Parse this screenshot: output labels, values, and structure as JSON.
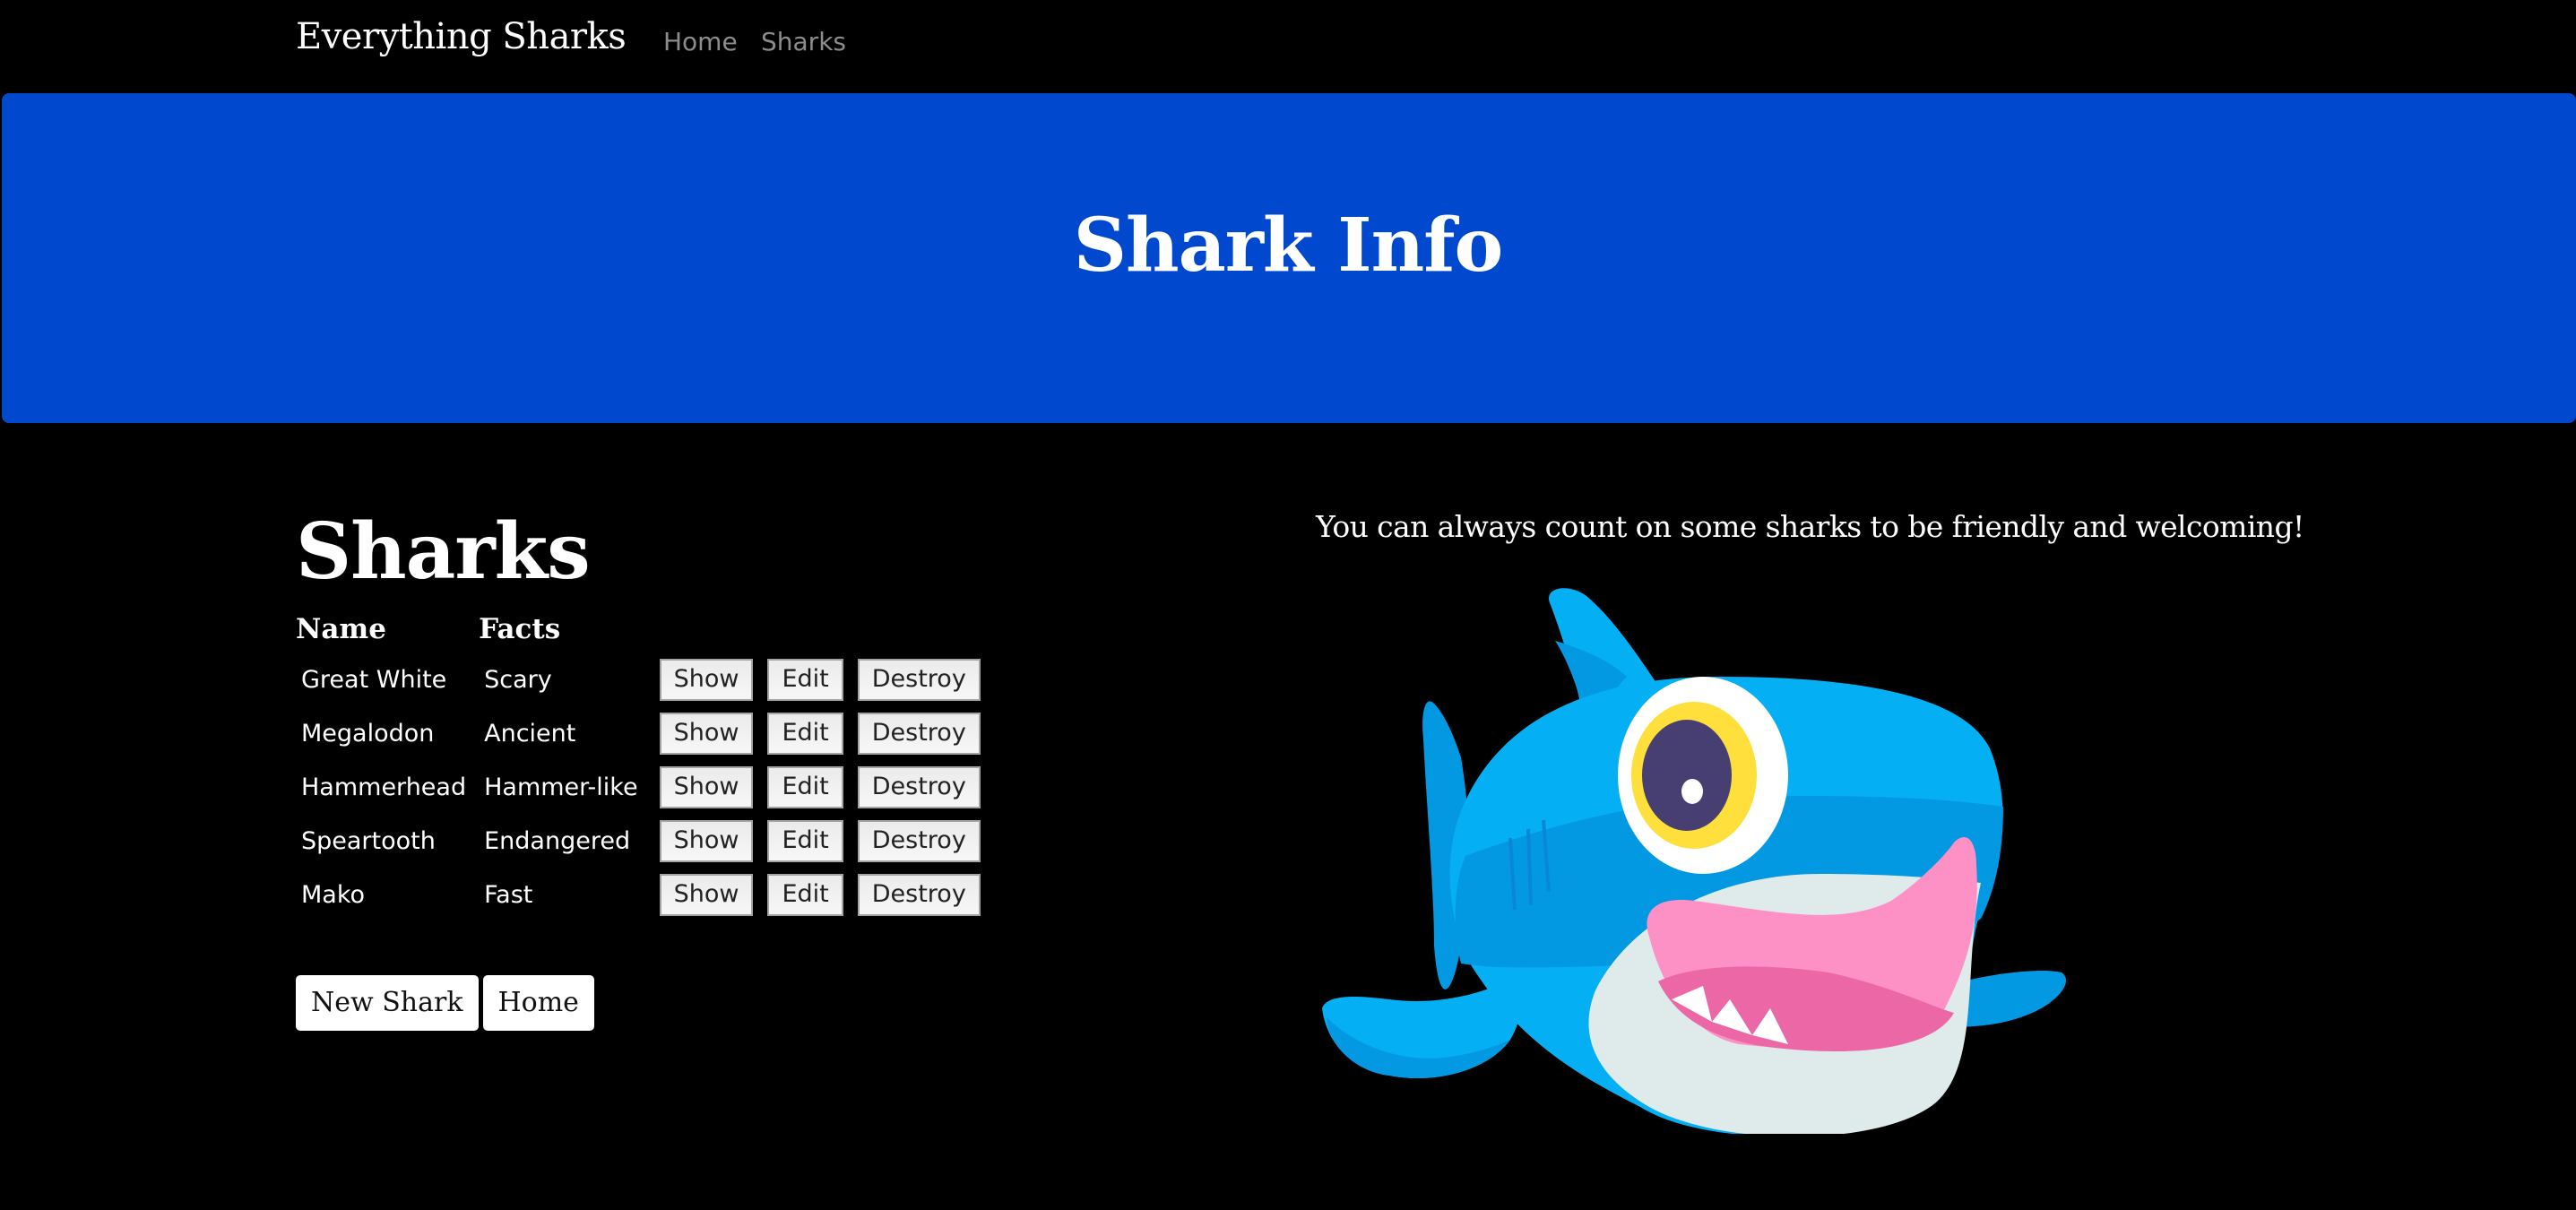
{
  "navbar": {
    "brand": "Everything Sharks",
    "links": [
      {
        "label": "Home"
      },
      {
        "label": "Sharks"
      }
    ]
  },
  "jumbotron": {
    "title": "Shark Info",
    "background_color": "#0049cf"
  },
  "main": {
    "heading": "Sharks",
    "table": {
      "columns": [
        "Name",
        "Facts"
      ],
      "rows": [
        {
          "name": "Great White",
          "facts": "Scary"
        },
        {
          "name": "Megalodon",
          "facts": "Ancient"
        },
        {
          "name": "Hammerhead",
          "facts": "Hammer-like"
        },
        {
          "name": "Speartooth",
          "facts": "Endangered"
        },
        {
          "name": "Mako",
          "facts": "Fast"
        }
      ],
      "actions": {
        "show": "Show",
        "edit": "Edit",
        "destroy": "Destroy"
      }
    },
    "buttons": {
      "new_shark": "New Shark",
      "home": "Home"
    }
  },
  "aside": {
    "tagline": "You can always count on some sharks to be friendly and welcoming!",
    "image": "shark-cartoon-illustration"
  }
}
